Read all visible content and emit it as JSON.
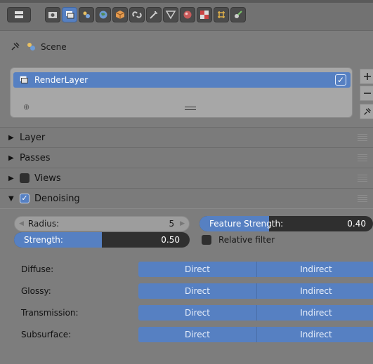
{
  "toolbar": {
    "icons": [
      "editor-type-icon",
      "render-icon",
      "render-layers-icon",
      "scene-icon",
      "world-icon",
      "object-icon",
      "constraints-icon",
      "modifiers-icon",
      "data-icon",
      "material-icon",
      "texture-icon",
      "particles-icon",
      "physics-icon"
    ],
    "active": "render-layers-icon"
  },
  "scene": {
    "label": "Scene"
  },
  "render_layers": {
    "items": [
      {
        "label": "RenderLayer",
        "enabled": true
      }
    ]
  },
  "panels": {
    "layer": "Layer",
    "passes": "Passes",
    "views": "Views",
    "denoising": "Denoising"
  },
  "denoising": {
    "radius_label": "Radius:",
    "radius_value": "5",
    "strength_label": "Strength:",
    "strength_value": "0.50",
    "strength_fraction": 0.5,
    "feature_strength_label": "Feature Strength:",
    "feature_strength_value": "0.40",
    "feature_strength_fraction": 0.4,
    "relative_filter_label": "Relative filter",
    "relative_filter": false
  },
  "passes_table": [
    {
      "label": "Diffuse:",
      "direct": "Direct",
      "indirect": "Indirect"
    },
    {
      "label": "Glossy:",
      "direct": "Direct",
      "indirect": "Indirect"
    },
    {
      "label": "Transmission:",
      "direct": "Direct",
      "indirect": "Indirect"
    },
    {
      "label": "Subsurface:",
      "direct": "Direct",
      "indirect": "Indirect"
    }
  ],
  "colors": {
    "accent": "#5680c2",
    "panel": "#7d7d7d",
    "slider_bg": "#2f2f2f"
  }
}
